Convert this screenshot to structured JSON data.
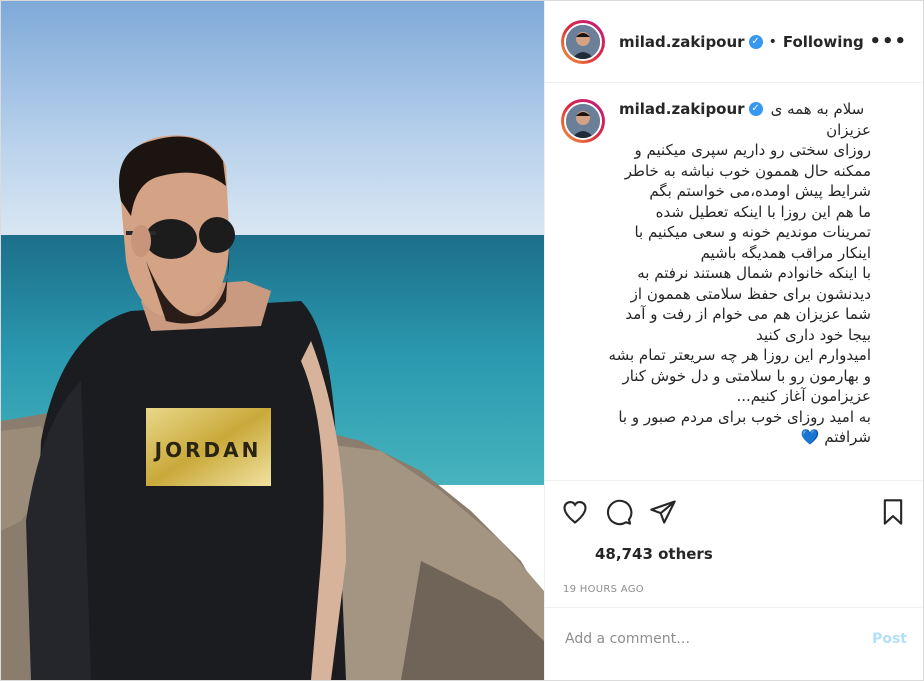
{
  "post": {
    "username": "milad.zakipour",
    "verified_mark": "✓",
    "separator": "•",
    "follow_status": "Following",
    "more_icon": "more-horizontal-icon",
    "more_label": "•••",
    "caption": {
      "username": "milad.zakipour",
      "lines": [
        "سلام به همه ی",
        "عزیزان",
        "روزای سختی رو داریم سپری میکنیم و",
        "ممکنه حال هممون خوب نباشه به خاطر",
        "شرایط پیش اومده،می خواستم بگم",
        "ما هم این روزا با اینکه تعطیل شده",
        "تمرینات موندیم خونه و سعی میکنیم با",
        "اینکار مراقب همدیگه باشیم",
        "با اینکه خانوادم شمال هستند نرفتم به",
        "دیدنشون برای حفظ سلامتی هممون از",
        "شما عزیزان هم می خوام از رفت و آمد",
        "بیجا خود داری کنید",
        "امیدوارم این روزا هر چه سریعتر تمام بشه",
        "و بهارمون رو با سلامتی و دل خوش کنار",
        "عزیزامون آغاز کنیم...",
        "به امید روزای خوب برای مردم صبور و با",
        "شرافتم 💙"
      ]
    },
    "likes": "48,743 others",
    "timestamp": "19 HOURS AGO",
    "comment_placeholder": "Add a comment…",
    "post_button": "Post",
    "photo_shirt_text": "JORDAN",
    "colors": {
      "verified": "#3897f0",
      "post_button": "#b2dffc",
      "muted": "#8e8e8e"
    }
  }
}
